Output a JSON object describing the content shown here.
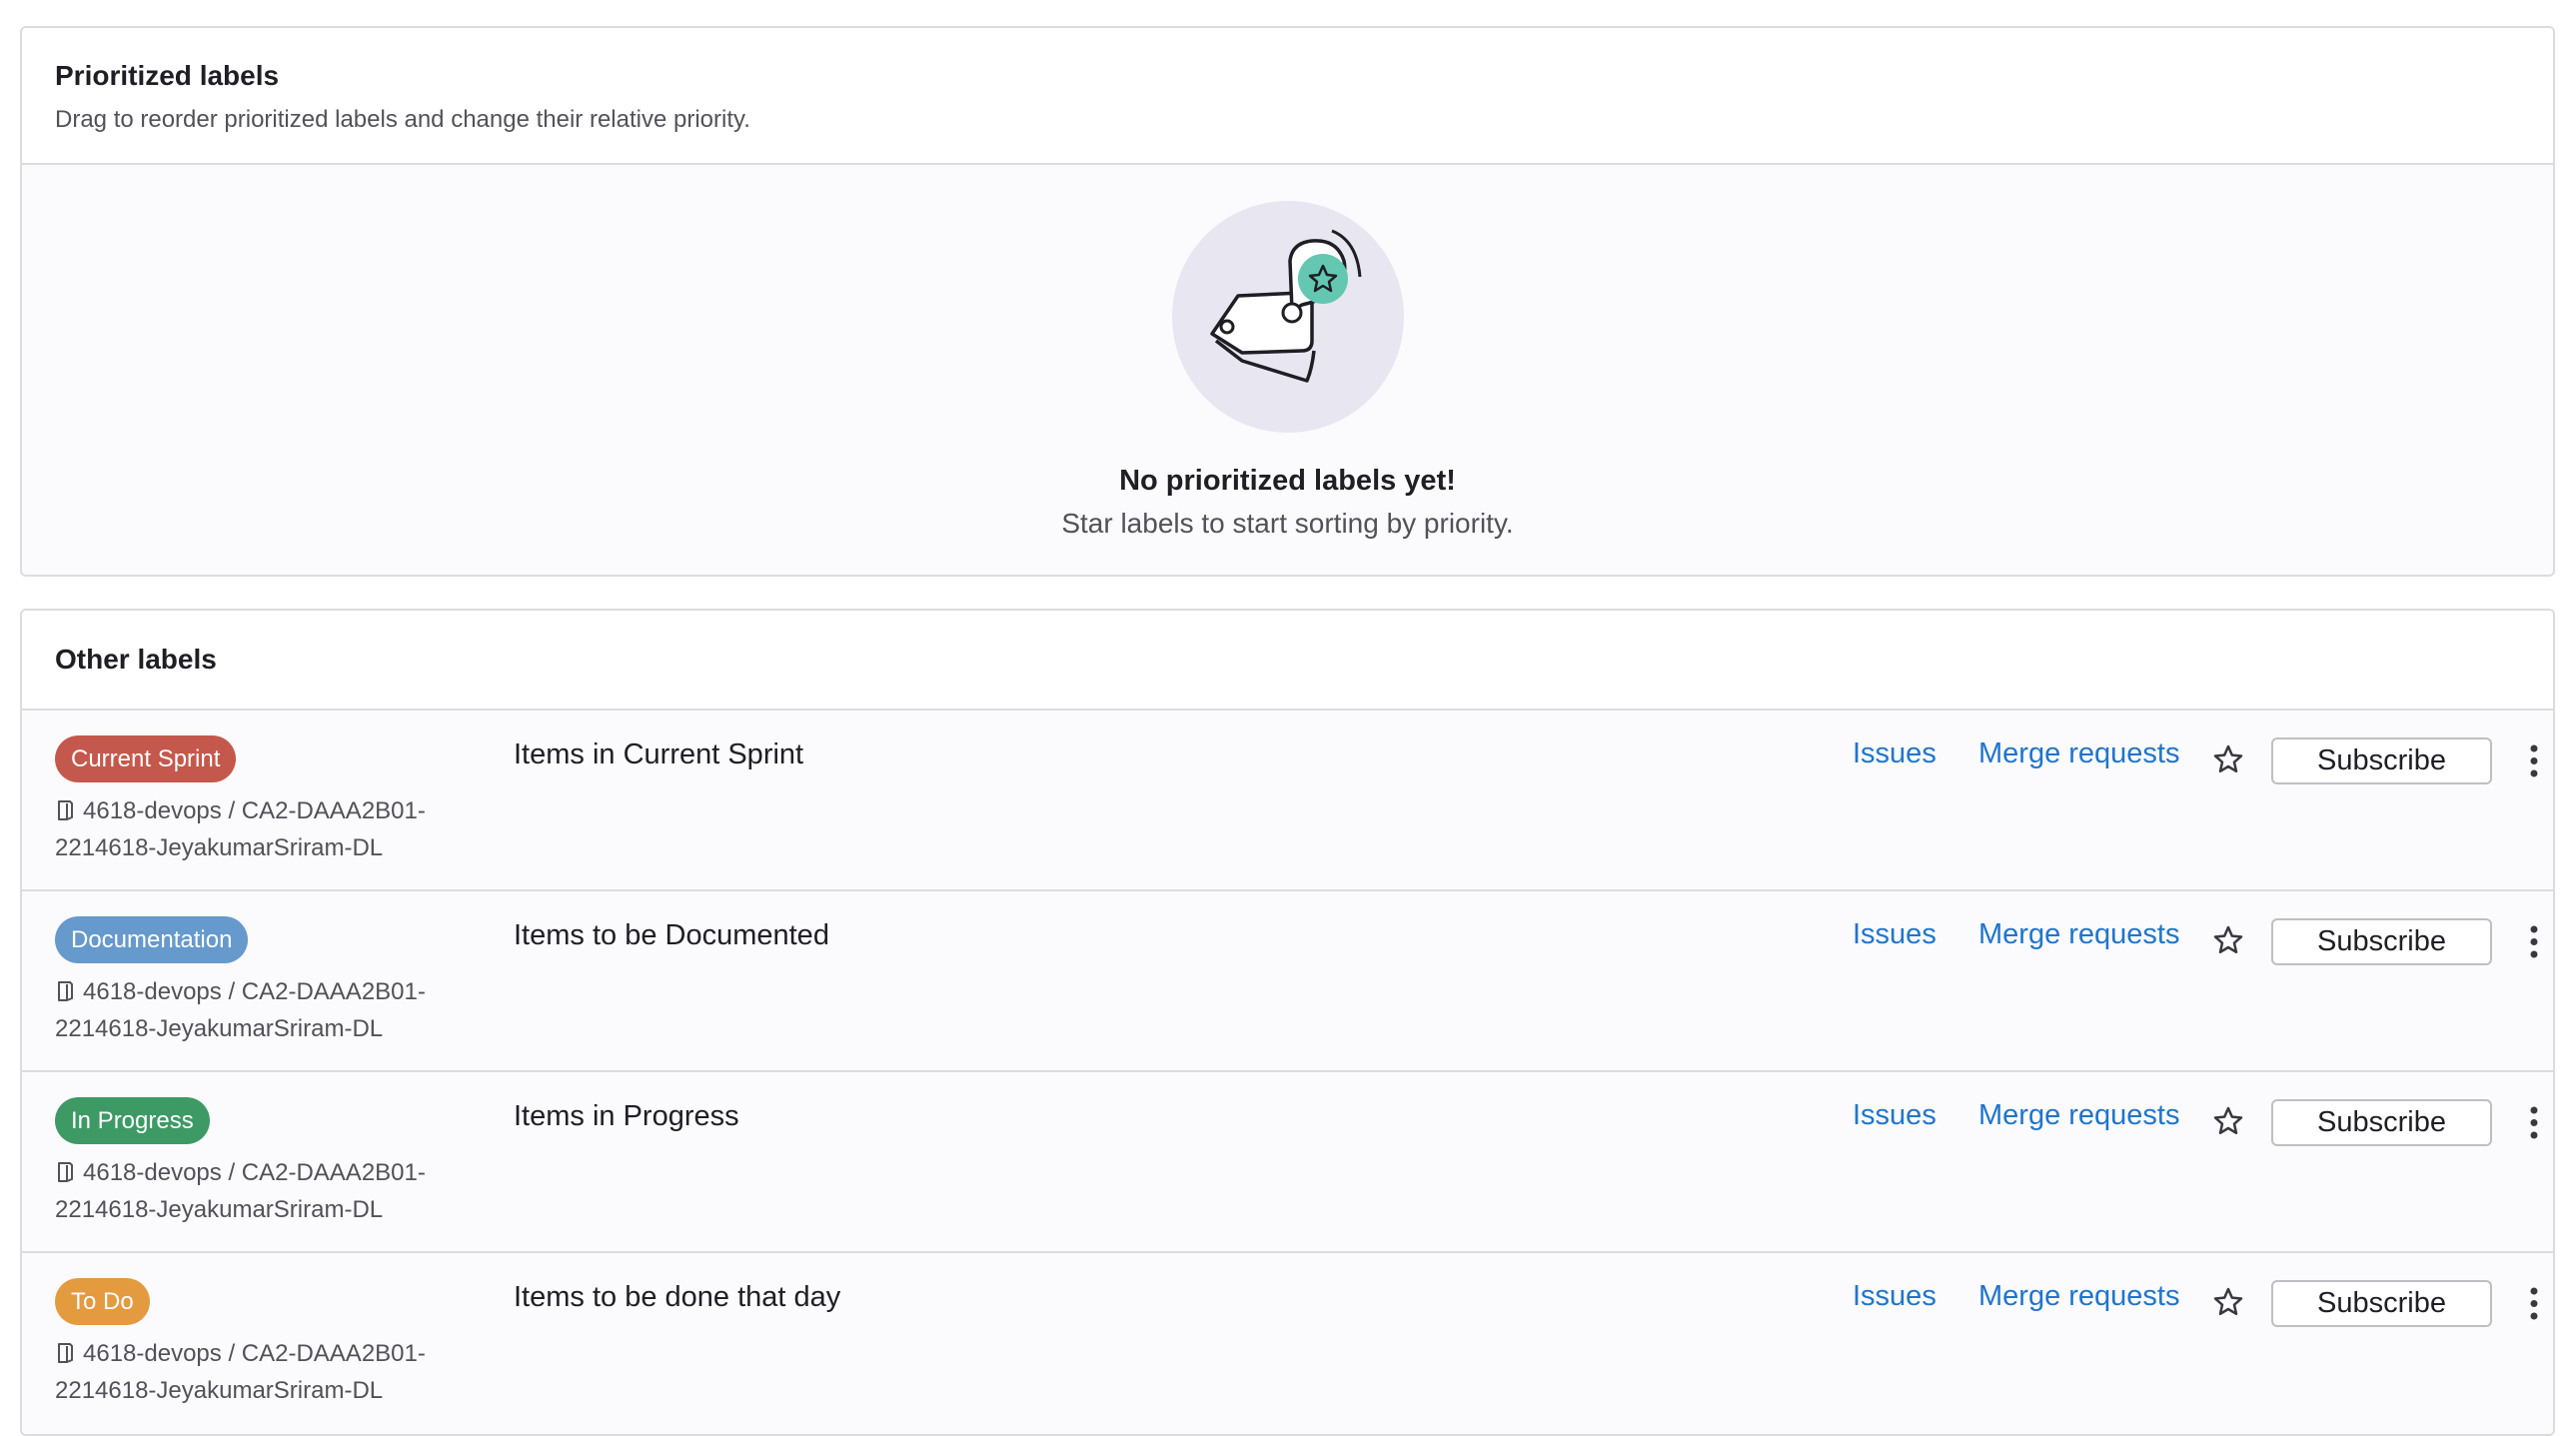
{
  "prioritized": {
    "title": "Prioritized labels",
    "subtitle": "Drag to reorder prioritized labels and change their relative priority.",
    "empty_title": "No prioritized labels yet!",
    "empty_desc": "Star labels to start sorting by priority."
  },
  "other": {
    "title": "Other labels",
    "labels": [
      {
        "name": "Current Sprint",
        "color": "#c5584c",
        "path": "4618-devops / CA2-DAAA2B01-2214618-JeyakumarSriram-DL",
        "description": "Items in Current Sprint",
        "issues_link": "Issues",
        "mr_link": "Merge requests",
        "subscribe": "Subscribe"
      },
      {
        "name": "Documentation",
        "color": "#6699cc",
        "path": "4618-devops / CA2-DAAA2B01-2214618-JeyakumarSriram-DL",
        "description": "Items to be Documented",
        "issues_link": "Issues",
        "mr_link": "Merge requests",
        "subscribe": "Subscribe"
      },
      {
        "name": "In Progress",
        "color": "#3d9a64",
        "path": "4618-devops / CA2-DAAA2B01-2214618-JeyakumarSriram-DL",
        "description": "Items in Progress",
        "issues_link": "Issues",
        "mr_link": "Merge requests",
        "subscribe": "Subscribe"
      },
      {
        "name": "To Do",
        "color": "#e49a3f",
        "path": "4618-devops / CA2-DAAA2B01-2214618-JeyakumarSriram-DL",
        "description": "Items to be done that day",
        "issues_link": "Issues",
        "mr_link": "Merge requests",
        "subscribe": "Subscribe"
      }
    ]
  },
  "colors": {
    "link": "#1f75cb",
    "border": "#dcdcde",
    "row_bg": "#fbfafd",
    "illustration_circle": "#e8e6f1",
    "illustration_star_bg": "#63c7b2"
  },
  "icons": {
    "repo": "repository-icon",
    "star": "star-outline-icon",
    "more": "ellipsis-vertical-icon",
    "illustration": "tag-with-star-illustration"
  }
}
